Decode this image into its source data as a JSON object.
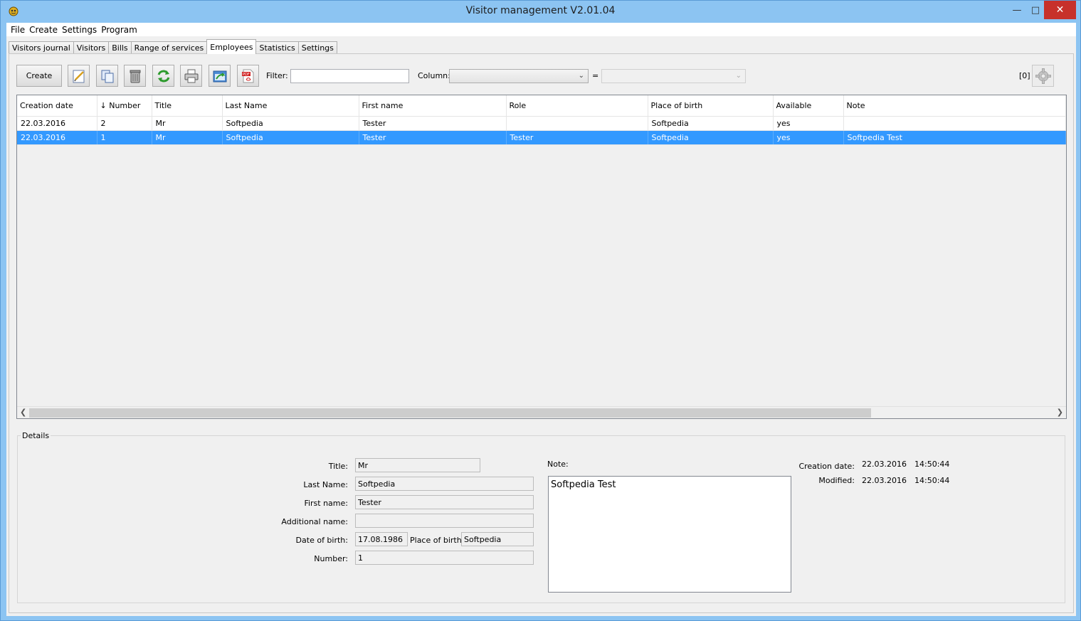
{
  "window": {
    "title": "Visitor management V2.01.04"
  },
  "menu": [
    "File",
    "Create",
    "Settings",
    "Program"
  ],
  "tabs": [
    "Visitors journal",
    "Visitors",
    "Bills",
    "Range of services",
    "Employees",
    "Statistics",
    "Settings"
  ],
  "active_tab": "Employees",
  "toolbar": {
    "create_label": "Create",
    "filter_label": "Filter:",
    "filter_value": "",
    "column_label": "Column:",
    "equals_label": "=",
    "count_label": "[0]"
  },
  "grid": {
    "columns": [
      "Creation date",
      "↓ Number",
      "Title",
      "Last Name",
      "First name",
      "Role",
      "Place of birth",
      "Available",
      "Note"
    ],
    "rows": [
      [
        "22.03.2016",
        "2",
        "Mr",
        "Softpedia",
        "Tester",
        "",
        "Softpedia",
        "yes",
        ""
      ],
      [
        "22.03.2016",
        "1",
        "Mr",
        "Softpedia",
        "Tester",
        "Tester",
        "Softpedia",
        "yes",
        "Softpedia Test"
      ]
    ],
    "selected_row": 1
  },
  "details": {
    "legend": "Details",
    "title_label": "Title:",
    "title_value": "Mr",
    "last_name_label": "Last Name:",
    "last_name_value": "Softpedia",
    "first_name_label": "First name:",
    "first_name_value": "Tester",
    "additional_name_label": "Additional name:",
    "additional_name_value": "",
    "dob_label": "Date of birth:",
    "dob_value": "17.08.1986",
    "pob_label": "Place of birth:",
    "pob_value": "Softpedia",
    "number_label": "Number:",
    "number_value": "1",
    "note_label": "Note:",
    "note_value": "Softpedia Test",
    "creation_label": "Creation date:",
    "creation_date": "22.03.2016",
    "creation_time": "14:50:44",
    "modified_label": "Modified:",
    "modified_date": "22.03.2016",
    "modified_time": "14:50:44"
  }
}
